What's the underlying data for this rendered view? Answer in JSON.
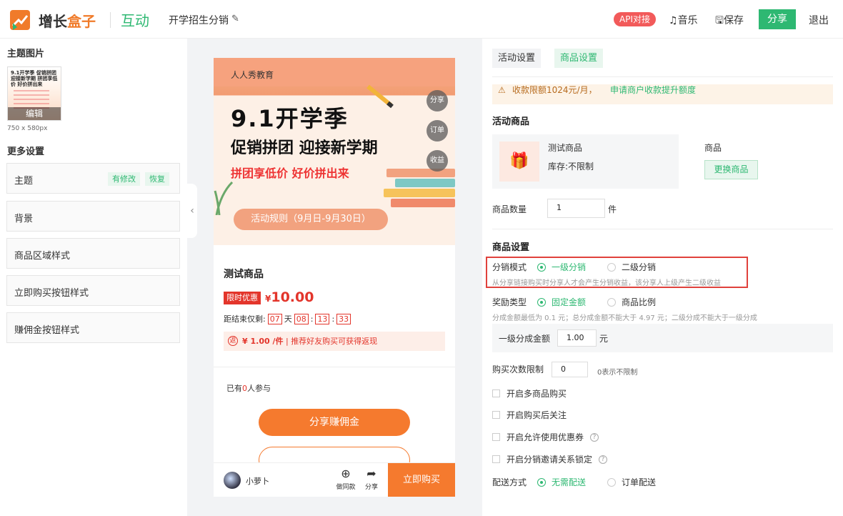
{
  "header": {
    "brand_prefix": "增长",
    "brand_suffix": "盒子",
    "module": "互动",
    "page_title": "开学招生分销",
    "api_badge": "API对接",
    "music": "音乐",
    "save": "保存",
    "share": "分享",
    "exit": "退出"
  },
  "left": {
    "theme_image_title": "主题图片",
    "thumb_edit": "编辑",
    "thumb_text": "9.1开学季 促销拼团 迎接新学期 拼团享低价 好价拼出来",
    "thumb_size": "750 x 580px",
    "more_settings_title": "更多设置",
    "rows": [
      {
        "label": "主题",
        "modified": "有修改",
        "restore": "恢复"
      },
      {
        "label": "背景"
      },
      {
        "label": "商品区域样式"
      },
      {
        "label": "立即购买按钮样式"
      },
      {
        "label": "赚佣金按钮样式"
      }
    ]
  },
  "phone": {
    "org": "人人秀教育",
    "headline": "9.1开学季",
    "sub1": "促销拼团 迎接新学期",
    "sub2": "拼团享低价 好价拼出来",
    "rules": "活动规则（9月日-9月30日）",
    "fab_share": "分享",
    "fab_order": "订单",
    "fab_income": "收益",
    "product_title": "测试商品",
    "limit_tag": "限时优惠",
    "price_symbol": "¥",
    "price": "10.00",
    "countdown_label": "距结束仅剩:",
    "cd_days": "07",
    "cd_day_unit": "天",
    "cd_h": "08",
    "cd_m": "13",
    "cd_s": "33",
    "rebate_icon": "返",
    "rebate_amount": "¥ 1.00 /件",
    "rebate_text": "推荐好友购买可获得返现",
    "joined_prefix": "已有",
    "joined_count": "0",
    "joined_suffix": "人参与",
    "share_earn": "分享赚佣金",
    "user_name": "小萝卜",
    "same_style": "做同款",
    "share_icon_label": "分享",
    "buy_now": "立即购买"
  },
  "right": {
    "tab_activity": "活动设置",
    "tab_product": "商品设置",
    "notice_left": "收款限额1024元/月，",
    "notice_right": "申请商户收款提升额度",
    "activity_products_title": "活动商品",
    "product_name": "测试商品",
    "product_stock": "库存:不限制",
    "product_label": "商品",
    "change_product": "更换商品",
    "qty_label": "商品数量",
    "qty_value": "1",
    "qty_unit": "件",
    "product_settings_title": "商品设置",
    "dist_mode_label": "分销模式",
    "dist_level1": "一级分销",
    "dist_level2": "二级分销",
    "dist_hint": "从分享链接购买时分享人才会产生分销收益，该分享人上级产生二级收益",
    "reward_type_label": "奖励类型",
    "reward_fixed": "固定金额",
    "reward_ratio": "商品比例",
    "reward_hint": "分成金额最低为 0.1 元；总分成金额不能大于 4.97 元；二级分成不能大于一级分成",
    "level1_amount_label": "一级分成金额",
    "level1_amount_value": "1.00",
    "level1_amount_unit": "元",
    "limit_label": "购买次数限制",
    "limit_value": "0",
    "limit_hint": "0表示不限制",
    "opt1": "开启多商品购买",
    "opt2": "开启购买后关注",
    "opt3": "开启允许使用优惠券",
    "opt4": "开启分销邀请关系锁定",
    "delivery_label": "配送方式",
    "delivery_none": "无需配送",
    "delivery_order": "订单配送"
  },
  "colors": {
    "accent": "#2eb872",
    "orange": "#f57a2e",
    "red": "#e3352b",
    "highlight_box": "#e0413c"
  }
}
